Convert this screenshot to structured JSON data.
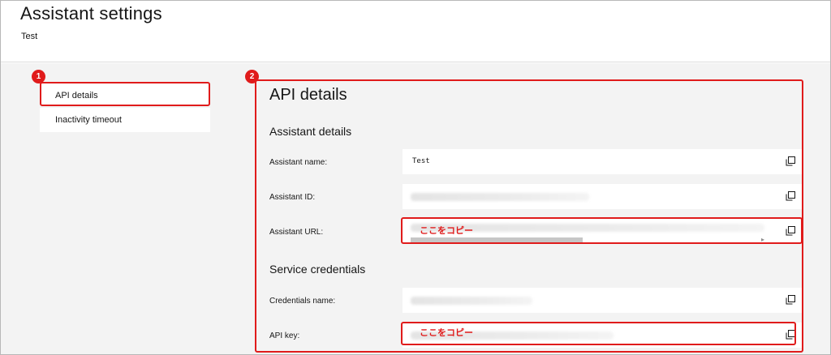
{
  "header": {
    "title": "Assistant settings",
    "subtitle": "Test"
  },
  "sidebar": {
    "items": [
      {
        "label": "API details",
        "active": true
      },
      {
        "label": "Inactivity timeout",
        "active": false
      }
    ]
  },
  "badges": {
    "one": "1",
    "two": "2"
  },
  "panel": {
    "title": "API details",
    "assistant_details": {
      "heading": "Assistant details",
      "name_label": "Assistant name:",
      "name_value": "Test",
      "id_label": "Assistant ID:",
      "url_label": "Assistant URL:"
    },
    "service_credentials": {
      "heading": "Service credentials",
      "cred_name_label": "Credentials name:",
      "api_key_label": "API key:"
    }
  },
  "annotations": {
    "copy_here_url": "ここをコピー",
    "copy_here_key": "ここをコピー"
  },
  "colors": {
    "highlight": "#e01b1b",
    "background": "#f3f3f3"
  },
  "icons": {
    "copy": "copy-icon"
  }
}
